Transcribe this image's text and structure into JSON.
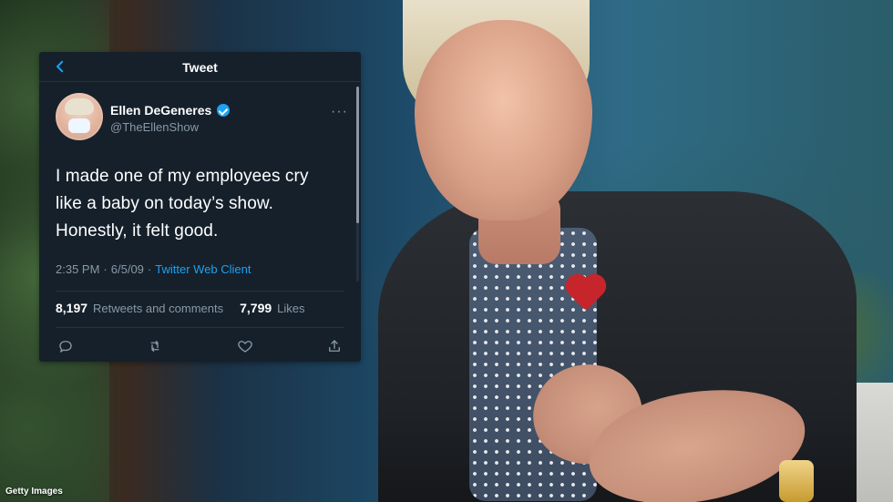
{
  "tweet": {
    "header_title": "Tweet",
    "author": {
      "name": "Ellen DeGeneres",
      "handle": "@TheEllenShow"
    },
    "text_lines": [
      "I made one of my employees cry",
      "like a baby on today’s show.",
      "Honestly, it felt good."
    ],
    "meta": {
      "time": "2:35 PM",
      "sep1": "·",
      "date": "6/5/09",
      "sep2": "·",
      "source": "Twitter Web Client"
    },
    "stats": {
      "retweets_comments_count": "8,197",
      "retweets_comments_label": "Retweets and comments",
      "likes_count": "7,799",
      "likes_label": "Likes"
    }
  },
  "photo_credit": "Getty Images",
  "icons": {
    "back": "chevron-left-icon",
    "verified": "verified-badge-icon",
    "more": "more-icon",
    "reply": "reply-icon",
    "retweet": "retweet-icon",
    "like": "heart-icon",
    "share": "share-icon"
  },
  "colors": {
    "tweet_bg": "#15202b",
    "muted_text": "#8899a6",
    "accent_blue": "#1da1f2"
  }
}
